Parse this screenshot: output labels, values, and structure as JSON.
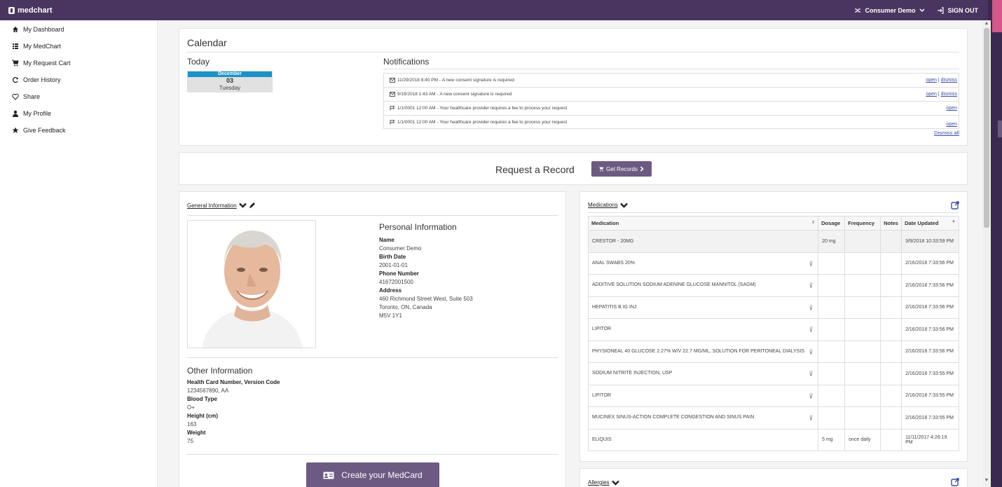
{
  "app": {
    "brand": "medchart"
  },
  "topbar": {
    "user": "Consumer Demo",
    "signout": "SIGN OUT"
  },
  "sidebar": {
    "items": [
      {
        "label": "My Dashboard",
        "icon": "home-icon"
      },
      {
        "label": "My MedChart",
        "icon": "list-icon"
      },
      {
        "label": "My Request Cart",
        "icon": "cart-icon"
      },
      {
        "label": "Order History",
        "icon": "refresh-icon"
      },
      {
        "label": "Share",
        "icon": "heart-icon"
      },
      {
        "label": "My Profile",
        "icon": "user-icon"
      },
      {
        "label": "Give Feedback",
        "icon": "star-icon"
      }
    ]
  },
  "calendar": {
    "title": "Calendar",
    "today_label": "Today",
    "month": "December",
    "day": "03",
    "weekday": "Tuesday",
    "notifications_label": "Notifications",
    "notifications": [
      {
        "time": "11/29/2018 8:40 PM",
        "text": "A new consent signature is required",
        "open": "open",
        "dismiss": "dismiss",
        "icon": "envelope-icon"
      },
      {
        "time": "9/19/2018 1:43 AM",
        "text": "A new consent signature is required",
        "open": "open",
        "dismiss": "dismiss",
        "icon": "envelope-icon"
      },
      {
        "time": "1/1/0001 12:00 AM",
        "text": "Your healthcare provider requires a fee to process your request",
        "open": "open",
        "dismiss": "",
        "icon": "flag-icon"
      },
      {
        "time": "1/1/0001 12:00 AM",
        "text": "Your healthcare provider requires a fee to process your request",
        "open": "open",
        "dismiss": "",
        "icon": "flag-icon"
      }
    ],
    "dismiss_all": "Dismiss all"
  },
  "request": {
    "title": "Request a Record",
    "button": "Get Records"
  },
  "general": {
    "title": "General Information",
    "personal_title": "Personal Information",
    "fields": {
      "name_label": "Name",
      "name": "Consumer Demo",
      "birth_label": "Birth Date",
      "birth": "2001-01-01",
      "phone_label": "Phone Number",
      "phone": "41672001500",
      "address_label": "Address",
      "address1": "460 Richmond Street West, Suite 503",
      "address2": "Toronto, ON, Canada",
      "address3": "M5V 1Y1"
    },
    "other_title": "Other Information",
    "other": {
      "hc_label": "Health Card Number, Version Code",
      "hc": "1234567890, AA",
      "blood_label": "Blood Type",
      "blood": "O+",
      "height_label": "Height (cm)",
      "height": "163",
      "weight_label": "Weight",
      "weight": "75"
    },
    "medcard_button": "Create your MedCard"
  },
  "medications": {
    "title": "Medications",
    "columns": [
      "Medication",
      "Dosage",
      "Frequency",
      "Notes",
      "Date Updated"
    ],
    "rows": [
      {
        "name": "CRESTOR - 20MG",
        "dosage": "20 mg",
        "frequency": "",
        "notes": "",
        "date": "3/9/2018 10:33:59 PM",
        "bulb": false
      },
      {
        "name": "ANAL SWABS 20%",
        "dosage": "",
        "frequency": "",
        "notes": "",
        "date": "2/16/2018 7:33:56 PM",
        "bulb": true
      },
      {
        "name": "ADDITIVE SOLUTION SODIUM ADENINE GLUCOSE MANNITOL (SAGM)",
        "dosage": "",
        "frequency": "",
        "notes": "",
        "date": "2/16/2018 7:33:56 PM",
        "bulb": true
      },
      {
        "name": "HEPATITIS B IG INJ",
        "dosage": "",
        "frequency": "",
        "notes": "",
        "date": "2/16/2018 7:33:56 PM",
        "bulb": true
      },
      {
        "name": "LIPITOR",
        "dosage": "",
        "frequency": "",
        "notes": "",
        "date": "2/16/2018 7:33:56 PM",
        "bulb": true
      },
      {
        "name": "PHYSIONEAL 40 GLUCOSE 2.27% W/V 22.7 MG/ML, SOLUTION FOR PERITONEAL DIALYSIS",
        "dosage": "",
        "frequency": "",
        "notes": "",
        "date": "2/16/2018 7:33:56 PM",
        "bulb": true
      },
      {
        "name": "SODIUM NITRITE INJECTION, USP",
        "dosage": "",
        "frequency": "",
        "notes": "",
        "date": "2/16/2018 7:33:55 PM",
        "bulb": true
      },
      {
        "name": "LIPITOR",
        "dosage": "",
        "frequency": "",
        "notes": "",
        "date": "2/16/2018 7:33:55 PM",
        "bulb": true
      },
      {
        "name": "MUCINEX SINUS-ACTION COMPLETE CONGESTION AND SINUS PAIN",
        "dosage": "",
        "frequency": "",
        "notes": "",
        "date": "2/16/2018 7:33:55 PM",
        "bulb": true
      },
      {
        "name": "ELIQUIS",
        "dosage": "5 mg",
        "frequency": "once daily",
        "notes": "",
        "date": "11/11/2017 4:26:19 PM",
        "bulb": false
      }
    ]
  },
  "allergies": {
    "title": "Allergies"
  }
}
